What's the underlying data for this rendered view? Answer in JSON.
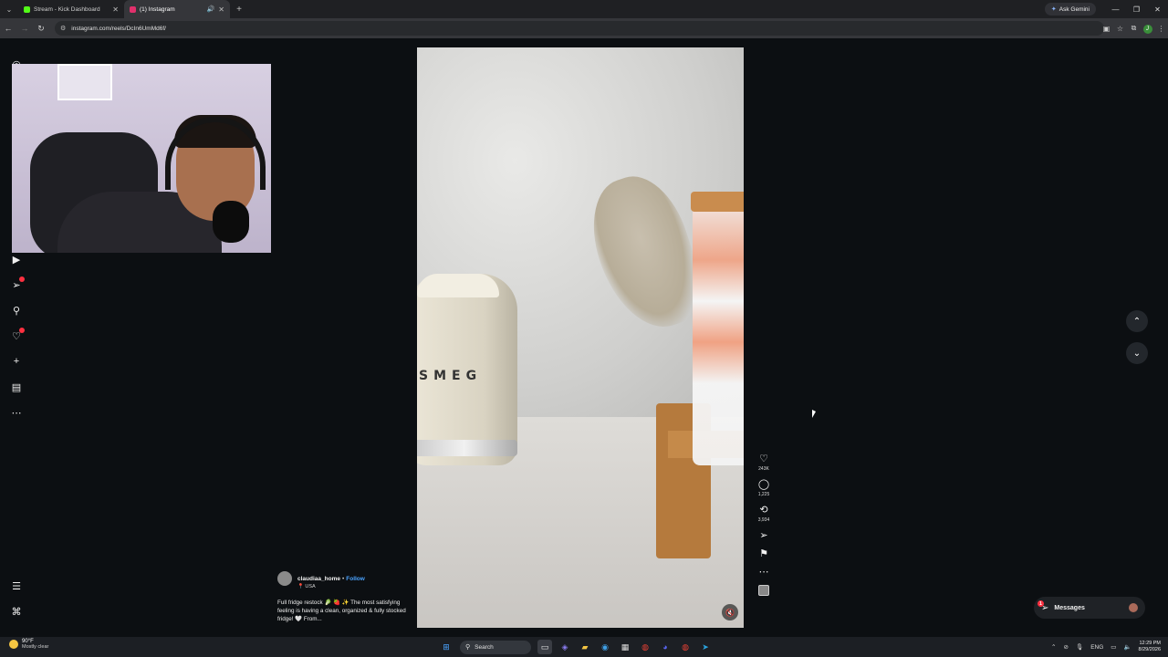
{
  "browser": {
    "tabs": [
      {
        "title": "Stream - Kick Dashboard",
        "favicon_color": "#53fc18",
        "active": false
      },
      {
        "title": "(1) Instagram",
        "favicon_color": "#e1306c",
        "active": true
      }
    ],
    "ask_gemini": "Ask Gemini",
    "url": "instagram.com/reels/DcIn6UmMd6f/",
    "profile_initial": "J"
  },
  "reel": {
    "username": "claudiaa_home",
    "follow": "Follow",
    "separator": "•",
    "location": "USA",
    "caption": "Full fridge restock 🥬 🍓 ✨ The most satisfying feeling is having a clean, organized & fully stocked fridge! 🤍 From...",
    "kettle_brand": "SMEG",
    "likes": "243K",
    "comments": "1,225",
    "reposts": "3,934"
  },
  "messages": {
    "label": "Messages",
    "badge": "1"
  },
  "taskbar": {
    "temperature": "90°F",
    "weather": "Mostly clear",
    "search_placeholder": "Search",
    "language": "ENG",
    "time": "12:29 PM",
    "date": "8/29/2026"
  },
  "icons": {
    "instagram": "instagram-icon",
    "reels": "reels-icon",
    "direct": "send-icon",
    "search": "search-icon",
    "notifications": "heart-icon",
    "create": "plus-icon",
    "dashboard": "chart-icon",
    "more": "more-icon",
    "menu": "menu-icon",
    "threads": "threads-icon"
  },
  "colors": {
    "accent": "#4aa3ff",
    "notification": "#ff3040"
  }
}
